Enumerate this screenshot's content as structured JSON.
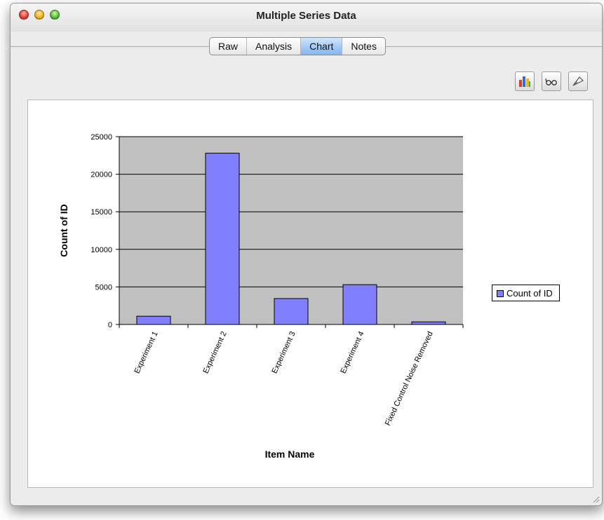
{
  "window": {
    "title": "Multiple Series Data"
  },
  "tabs": [
    {
      "label": "Raw",
      "selected": false
    },
    {
      "label": "Analysis",
      "selected": false
    },
    {
      "label": "Chart",
      "selected": true
    },
    {
      "label": "Notes",
      "selected": false
    }
  ],
  "toolbar": {
    "icons": [
      "chart-type-icon",
      "view-icon",
      "inspector-icon"
    ]
  },
  "colors": {
    "bar": "#8080ff",
    "plot_area": "#c0c0c0",
    "tab_selected": "#7fb6f0"
  },
  "chart_data": {
    "type": "bar",
    "title": "",
    "xlabel": "Item Name",
    "ylabel": "Count of ID",
    "categories": [
      "Experiment 1",
      "Experiment 2",
      "Experiment 3",
      "Experiment 4",
      "Fixed Control Noise Removed"
    ],
    "series": [
      {
        "name": "Count of ID",
        "values": [
          1100,
          22800,
          3450,
          5300,
          350
        ]
      }
    ],
    "ylim": [
      0,
      25000
    ],
    "yticks": [
      "0",
      "5000",
      "10000",
      "15000",
      "20000",
      "25000"
    ],
    "grid": true,
    "legend_position": "right"
  }
}
